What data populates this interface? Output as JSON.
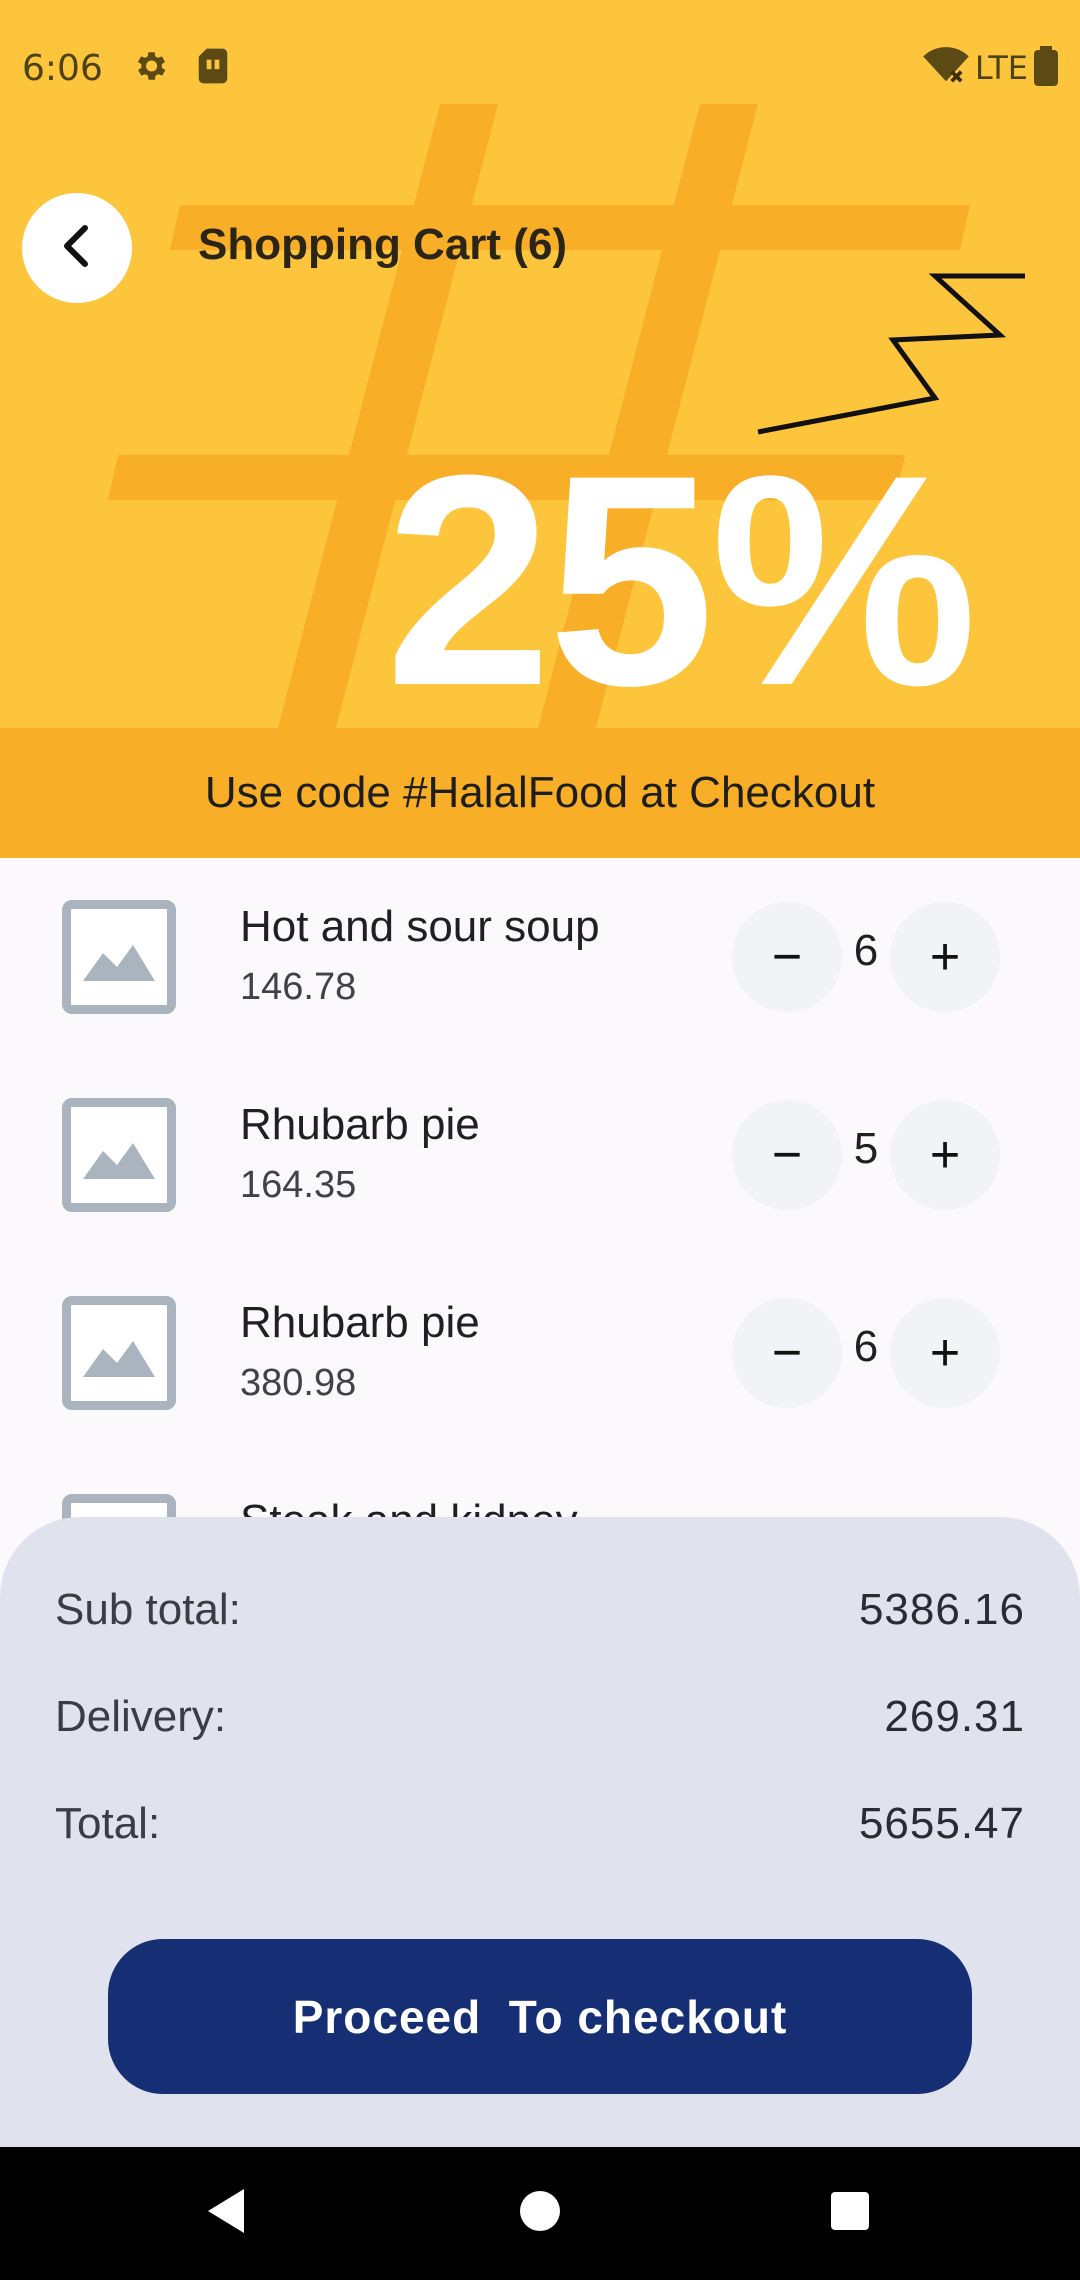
{
  "status_bar": {
    "time": "6:06",
    "network": "LTE",
    "icons": [
      "gear-icon",
      "sim-card-icon",
      "wifi-off-icon",
      "battery-icon"
    ]
  },
  "header": {
    "back_icon": "chevron-left-icon",
    "title": "Shopping Cart (6)",
    "promo_big": "25%",
    "promo_text": "Use code #HalalFood at Checkout"
  },
  "cart": {
    "items": [
      {
        "name": "Hot and sour soup",
        "price": "146.78",
        "quantity": "6"
      },
      {
        "name": "Rhubarb pie",
        "price": "164.35",
        "quantity": "5"
      },
      {
        "name": "Rhubarb pie",
        "price": "380.98",
        "quantity": "6"
      },
      {
        "name": "Steak and kidney",
        "price": "",
        "quantity": ""
      }
    ],
    "minus_symbol": "−",
    "plus_symbol": "+"
  },
  "totals": {
    "subtotal_label": "Sub total:",
    "subtotal_value": "5386.16",
    "delivery_label": "Delivery:",
    "delivery_value": "269.31",
    "total_label": "Total:",
    "total_value": "5655.47",
    "checkout_label": "Proceed  To checkout"
  },
  "colors": {
    "banner": "#fdc53c",
    "promo_strip": "#f8ae26",
    "checkout_button": "#162f74",
    "totals_sheet": "#e0e2ee"
  }
}
